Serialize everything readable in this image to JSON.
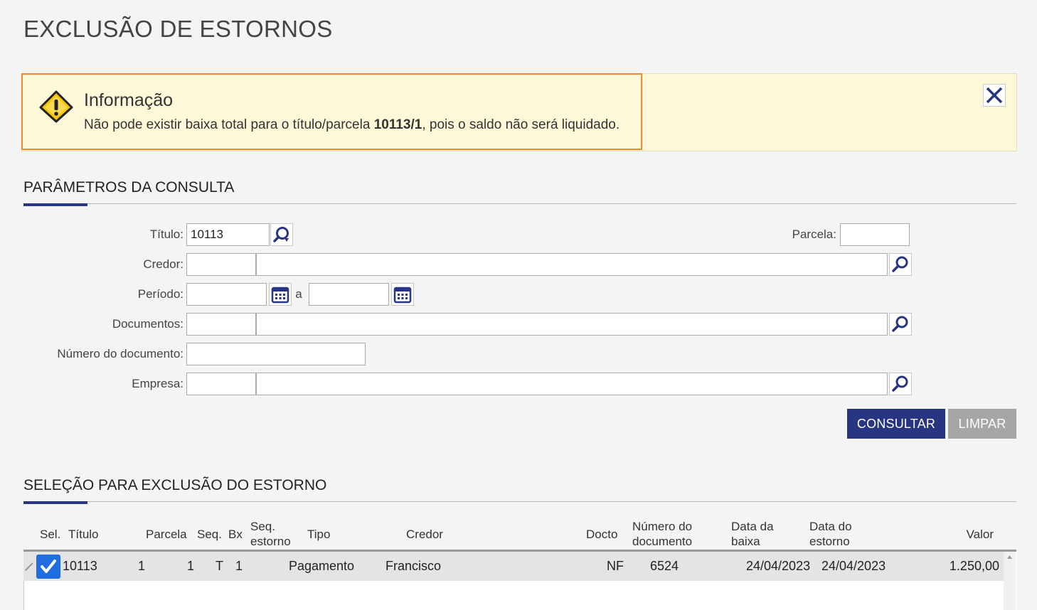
{
  "page": {
    "title": "EXCLUSÃO DE ESTORNOS"
  },
  "banner": {
    "title": "Informação",
    "msg_prefix": "Não pode existir baixa total para o título/parcela ",
    "msg_bold": "10113/1",
    "msg_suffix": ", pois o saldo não será liquidado.",
    "icon": "warning-icon",
    "close_icon": "close-icon"
  },
  "params": {
    "title": "PARÂMETROS DA CONSULTA",
    "titulo_label": "Título:",
    "titulo_value": "10113",
    "parcela_label": "Parcela:",
    "parcela_value": "",
    "credor_label": "Credor:",
    "periodo_label": "Período:",
    "periodo_sep": "a",
    "documentos_label": "Documentos:",
    "numero_doc_label": "Número do documento:",
    "empresa_label": "Empresa:",
    "consultar": "CONSULTAR",
    "limpar": "LIMPAR"
  },
  "selection": {
    "title": "SELEÇÃO PARA EXCLUSÃO DO ESTORNO",
    "headers": {
      "sel": "Sel.",
      "titulo": "Título",
      "parcela": "Parcela",
      "seq": "Seq.",
      "bx": "Bx",
      "seq_estorno_1": "Seq.",
      "seq_estorno_2": "estorno",
      "tipo": "Tipo",
      "credor": "Credor",
      "docto": "Docto",
      "numero_doc_1": "Número do",
      "numero_doc_2": "documento",
      "data_baixa_1": "Data da",
      "data_baixa_2": "baixa",
      "data_estorno_1": "Data do",
      "data_estorno_2": "estorno",
      "valor": "Valor"
    },
    "rows": [
      {
        "selected": true,
        "titulo": "10113",
        "parcela": "1",
        "seq": "1",
        "bx": "T",
        "seq_estorno": "1",
        "tipo": "Pagamento",
        "credor": "Francisco",
        "docto": "NF",
        "numero_doc": "6524",
        "data_baixa": "24/04/2023",
        "data_estorno": "24/04/2023",
        "valor": "1.250,00"
      }
    ]
  },
  "colors": {
    "accent": "#283583",
    "banner_bg": "#fdf8d7",
    "focus": "#f0892f",
    "checkbox": "#1f6de0"
  }
}
